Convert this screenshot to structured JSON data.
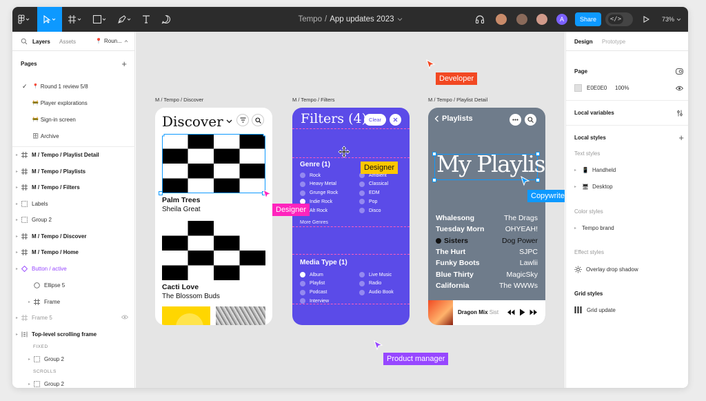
{
  "toolbar": {
    "project": "Tempo",
    "separator": "/",
    "file": "App updates 2023",
    "share_label": "Share",
    "zoom": "73%",
    "avatar_initial": "A",
    "dev_mode_glyph": "</>",
    "avatar_colors": [
      "#c98b6a",
      "#8a6a5a",
      "#d19a8a",
      "#7b61ff"
    ]
  },
  "layers_panel": {
    "tabs": [
      "Layers",
      "Assets"
    ],
    "page_selector": "Roun...",
    "pages_heading": "Pages",
    "pages": [
      {
        "label": "Round 1 review 5/8",
        "current": true,
        "emoji": "📍"
      },
      {
        "label": "Player explorations",
        "emoji": "🚧"
      },
      {
        "label": "Sign-in screen",
        "emoji": "🚧"
      },
      {
        "label": "Archive",
        "emoji": "🗄"
      }
    ],
    "layers": [
      {
        "label": "M / Tempo / Playlist Detail",
        "icon": "frame-icon",
        "style": "bold"
      },
      {
        "label": "M / Tempo / Playlists",
        "icon": "frame-icon",
        "style": "bold"
      },
      {
        "label": "M / Tempo / Filters",
        "icon": "frame-icon",
        "style": "bold"
      },
      {
        "label": "Labels",
        "icon": "section-icon",
        "style": "normal"
      },
      {
        "label": "Group 2",
        "icon": "section-icon",
        "style": "normal"
      },
      {
        "label": "M / Tempo / Discover",
        "icon": "frame-icon",
        "style": "bold"
      },
      {
        "label": "M / Tempo / Home",
        "icon": "frame-icon",
        "style": "bold"
      },
      {
        "label": "Button / active",
        "icon": "component-icon",
        "style": "purple"
      },
      {
        "label": "Ellipse 5",
        "icon": "ellipse-icon",
        "style": "normal"
      },
      {
        "label": "Frame",
        "icon": "frame-icon",
        "style": "normal"
      },
      {
        "label": "Frame 5",
        "icon": "frame-icon",
        "style": "muted"
      },
      {
        "label": "Top-level scrolling frame",
        "icon": "scroll-frame-icon",
        "style": "bold"
      },
      {
        "label": "FIXED",
        "icon": "",
        "style": "caption"
      },
      {
        "label": "Group 2",
        "icon": "section-icon",
        "style": "normal"
      },
      {
        "label": "SCROLLS",
        "icon": "",
        "style": "caption"
      },
      {
        "label": "Group 2",
        "icon": "section-icon",
        "style": "normal"
      }
    ]
  },
  "canvas": {
    "bg_color": "#e5e5e5",
    "frame_labels": [
      "M / Tempo / Discover",
      "M / Tempo / Filters",
      "M / Tempo / Playlist Detail"
    ],
    "discover": {
      "title": "Discover",
      "card1_title": "Palm Trees",
      "card1_artist": "Sheila Great",
      "card2_title": "Cacti Love",
      "card2_artist": "The Blossom Buds"
    },
    "filters": {
      "title": "Filters (4)",
      "clear_label": "Clear",
      "genre_heading": "Genre (1)",
      "genre_left": [
        "Rock",
        "Heavy Metal",
        "Grunge Rock",
        "Indie Rock",
        "Alt Rock"
      ],
      "genre_right": [
        "Ambient",
        "Classical",
        "EDM",
        "Pop",
        "Disco"
      ],
      "more_genres": "More Genres",
      "media_heading": "Media Type (1)",
      "media_left": [
        "Album",
        "Playlist",
        "Podcast",
        "Interview"
      ],
      "media_right": [
        "Live Music",
        "Radio",
        "Audio Book"
      ]
    },
    "playlist": {
      "back_label": "Playlists",
      "title": "My Playlist",
      "tracks": [
        {
          "song": "Whalesong",
          "artist": "The Drags"
        },
        {
          "song": "Tuesday Morn",
          "artist": "OHYEAH!"
        },
        {
          "song": "Sisters",
          "artist": "Dog Power"
        },
        {
          "song": "The Hurt",
          "artist": "SJPC"
        },
        {
          "song": "Funky Boots",
          "artist": "Lawlii"
        },
        {
          "song": "Blue Thirty",
          "artist": "MagicSky"
        },
        {
          "song": "California",
          "artist": "The WWWs"
        }
      ],
      "now_playing": "Dragon Mix",
      "now_playing_artist": "Sist"
    },
    "cursors": [
      {
        "label": "Developer",
        "color": "#f24822"
      },
      {
        "label": "Designer",
        "color": "#ff24bd"
      },
      {
        "label": "Designer",
        "color": "#ffc700"
      },
      {
        "label": "Copywriter",
        "color": "#0d99ff"
      },
      {
        "label": "Product manager",
        "color": "#9747ff"
      }
    ]
  },
  "design_panel": {
    "tabs": [
      "Design",
      "Prototype"
    ],
    "page_heading": "Page",
    "page_color": "E0E0E0",
    "page_opacity": "100%",
    "local_variables": "Local variables",
    "local_styles": "Local styles",
    "text_styles_heading": "Text styles",
    "text_styles": [
      "Handheld",
      "Desktop"
    ],
    "color_styles_heading": "Color styles",
    "color_styles": [
      "Tempo brand"
    ],
    "effect_styles_heading": "Effect styles",
    "effect_styles": [
      "Overlay drop shadow"
    ],
    "grid_styles_heading": "Grid styles",
    "grid_styles": [
      "Grid update"
    ]
  }
}
